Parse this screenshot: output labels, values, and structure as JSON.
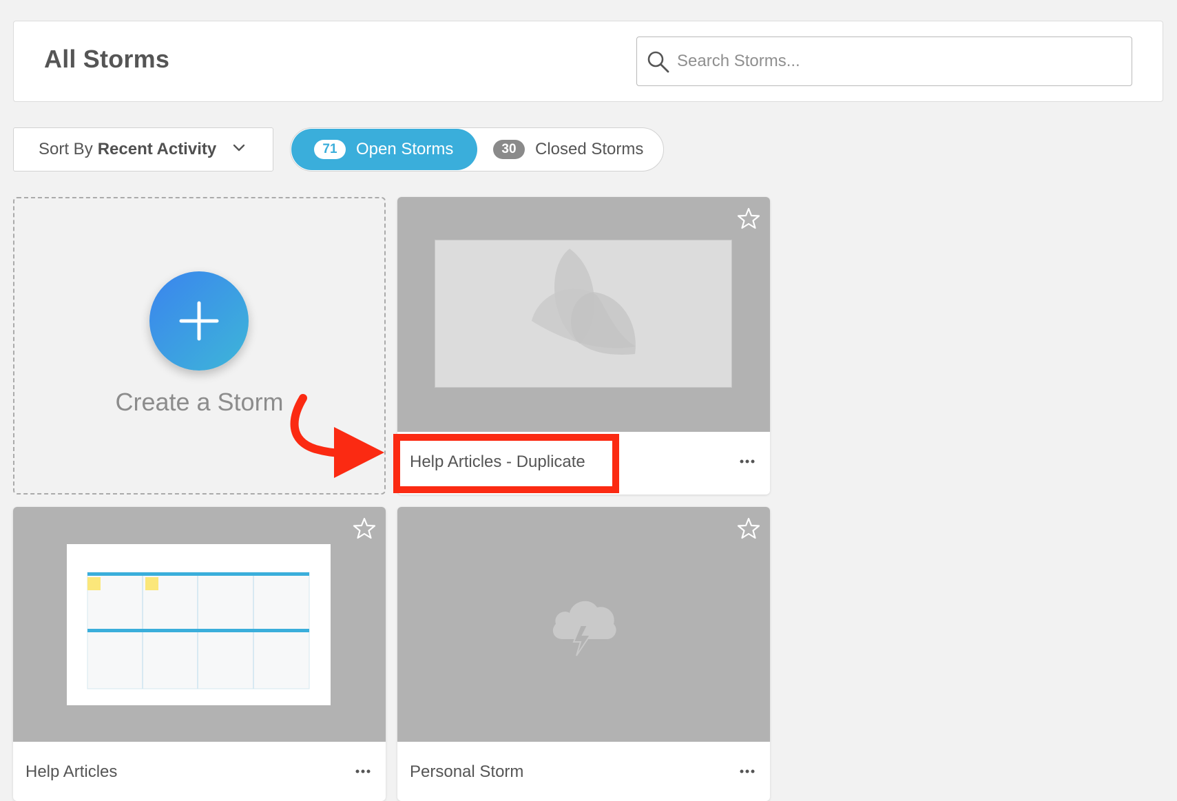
{
  "header": {
    "title": "All Storms",
    "search_placeholder": "Search Storms..."
  },
  "toolbar": {
    "sort_prefix": "Sort By",
    "sort_value": "Recent Activity",
    "open": {
      "count": "71",
      "label": "Open Storms"
    },
    "closed": {
      "count": "30",
      "label": "Closed Storms"
    }
  },
  "create_card": {
    "label": "Create a Storm"
  },
  "storms": [
    {
      "title": "Help Articles - Duplicate",
      "thumbnail": "placeholder-logo-icon",
      "highlighted": true
    },
    {
      "title": "Help Articles",
      "thumbnail": "sticky-note-board"
    },
    {
      "title": "Personal Storm",
      "thumbnail": "storm-cloud-icon"
    }
  ],
  "colors": {
    "accent": "#3aaedb",
    "card_thumb": "#b2b2b2",
    "annotation": "#fb2a12",
    "sticky_note": "#fbe77a"
  }
}
